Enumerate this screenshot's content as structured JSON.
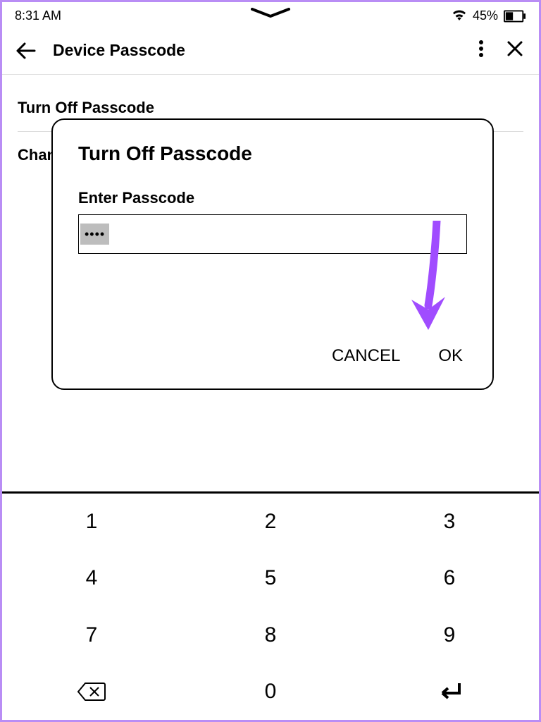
{
  "status": {
    "time": "8:31 AM",
    "battery_pct": "45%"
  },
  "header": {
    "title": "Device Passcode"
  },
  "rows": {
    "turn_off": "Turn Off Passcode",
    "change": "Change Passcode"
  },
  "modal": {
    "title": "Turn Off Passcode",
    "prompt": "Enter Passcode",
    "passcode_masked": "••••",
    "cancel": "CANCEL",
    "ok": "OK"
  },
  "keypad": {
    "k1": "1",
    "k2": "2",
    "k3": "3",
    "k4": "4",
    "k5": "5",
    "k6": "6",
    "k7": "7",
    "k8": "8",
    "k9": "9",
    "k0": "0"
  }
}
